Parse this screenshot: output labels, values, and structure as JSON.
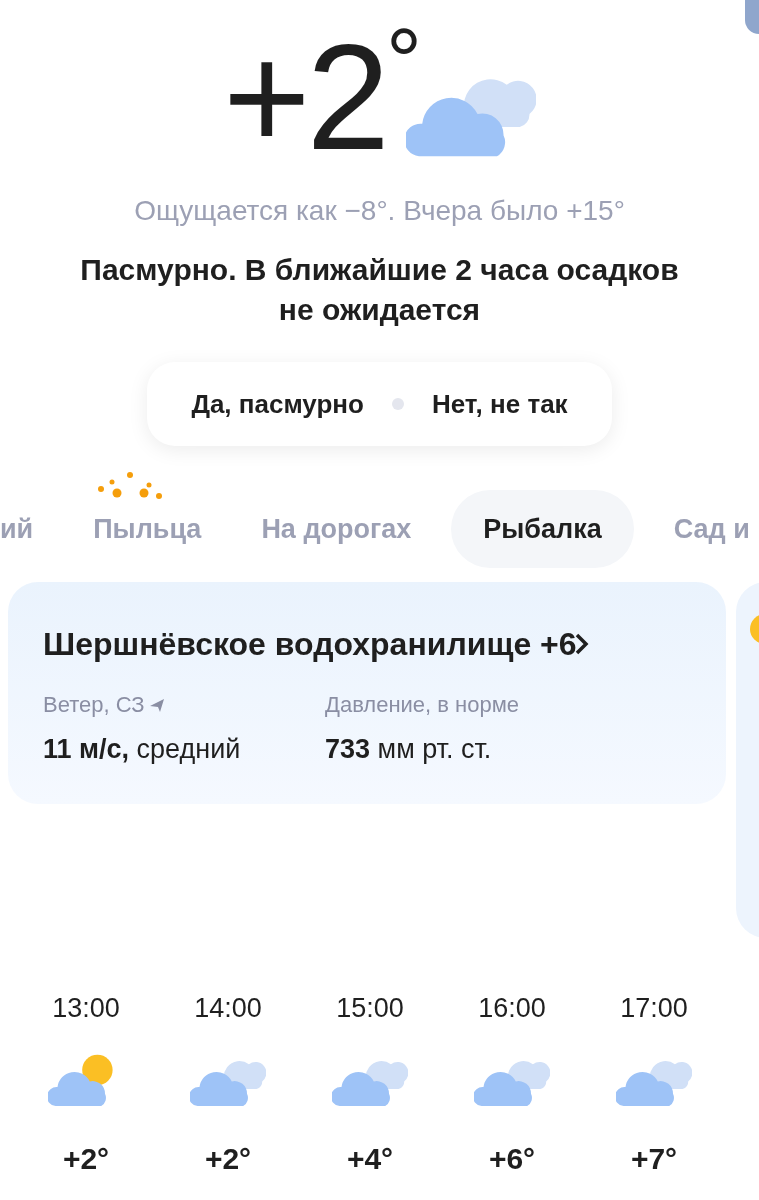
{
  "current": {
    "temperature": "+2",
    "degree": "°",
    "kind": "cloudy"
  },
  "feels_like": "Ощущается как −8°. Вчера было +15°",
  "summary": "Пасмурно. В ближайшие 2 часа осадков не ожидается",
  "feedback": {
    "yes": "Да, пасмурно",
    "no": "Нет, не так"
  },
  "tabs": [
    {
      "label": "ий",
      "selected": false,
      "badge": false
    },
    {
      "label": "Пыльца",
      "selected": false,
      "badge": true
    },
    {
      "label": "На дорогах",
      "selected": false,
      "badge": false
    },
    {
      "label": "Рыбалка",
      "selected": true,
      "badge": false
    },
    {
      "label": "Сад и",
      "selected": false,
      "badge": false
    }
  ],
  "fishing_card": {
    "title": "Шершнёвское водохранилище +6",
    "wind_label": "Ветер, СЗ",
    "wind_value": "**11 м/с,** средний",
    "pressure_label": "Давление, в норме",
    "pressure_value": "**733** мм рт. ст."
  },
  "hourly": [
    {
      "time": "13:00",
      "kind": "partly_sunny",
      "temp": "+2°"
    },
    {
      "time": "14:00",
      "kind": "cloudy",
      "temp": "+2°"
    },
    {
      "time": "15:00",
      "kind": "cloudy",
      "temp": "+4°"
    },
    {
      "time": "16:00",
      "kind": "cloudy",
      "temp": "+6°"
    },
    {
      "time": "17:00",
      "kind": "cloudy",
      "temp": "+7°"
    }
  ]
}
